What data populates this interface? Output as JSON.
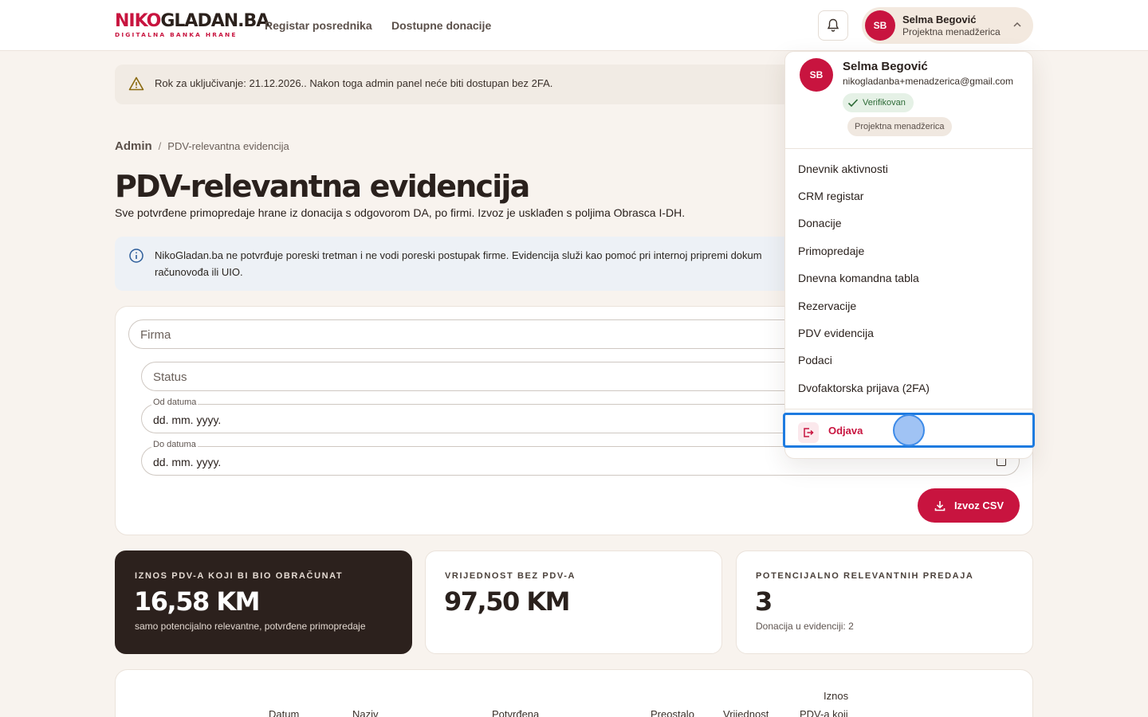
{
  "header": {
    "logo": {
      "part_a": "NIKO",
      "part_b": "GLADAN.BA",
      "tagline": "DIGITALNA BANKA HRANE"
    },
    "nav": [
      "Registar posrednika",
      "Dostupne donacije"
    ],
    "user": {
      "initials": "SB",
      "name": "Selma Begović",
      "role": "Projektna menadžerica"
    }
  },
  "warning": {
    "text": "Rok za uključivanje: 21.12.2026.. Nakon toga admin panel neće biti dostupan bez 2FA."
  },
  "breadcrumb": {
    "root": "Admin",
    "separator": "/",
    "current": "PDV-relevantna evidencija"
  },
  "page": {
    "title": "PDV-relevantna evidencija",
    "subtitle": "Sve potvrđene primopredaje hrane iz donacija s odgovorom DA, po firmi. Izvoz je usklađen s poljima Obrasca I-DH."
  },
  "info": {
    "text": "NikoGladan.ba ne potvrđuje poreski tretman i ne vodi poreski postupak firme. Evidencija služi kao pomoć pri internoj pripremi dokum računovođa ili UIO."
  },
  "filters": {
    "firma_placeholder": "Firma",
    "status_placeholder": "Status",
    "from_label": "Od datuma",
    "from_value": "dd. mm. yyyy.",
    "to_label": "Do datuma",
    "to_value": "dd. mm. yyyy.",
    "export_label": "Izvoz CSV"
  },
  "stats": [
    {
      "label": "IZNOS PDV-A KOJI BI BIO OBRAČUNAT",
      "value": "16,58 KM",
      "note": "samo potencijalno relevantne, potvrđene primopredaje"
    },
    {
      "label": "VRIJEDNOST BEZ PDV-A",
      "value": "97,50 KM",
      "note": ""
    },
    {
      "label": "POTENCIJALNO RELEVANTNIH PREDAJA",
      "value": "3",
      "note": "Donacija u evidenciji: 2"
    }
  ],
  "table": {
    "headers": [
      "Datum",
      "Naziv",
      "Potvrđena",
      "Preostalo",
      "Vrijednost",
      "Iznos",
      "PDV-a koji"
    ]
  },
  "menu": {
    "initials": "SB",
    "name": "Selma Begović",
    "email": "nikogladanba+menadzerica@gmail.com",
    "verified": "Verifikovan",
    "role": "Projektna menadžerica",
    "items": [
      "Dnevnik aktivnosti",
      "CRM registar",
      "Donacije",
      "Primopredaje",
      "Dnevna komandna tabla",
      "Rezervacije",
      "PDV evidencija",
      "Podaci",
      "Dvofaktorska prijava (2FA)"
    ],
    "logout": "Odjava"
  },
  "colors": {
    "brand": "#c8143f",
    "dark_card": "#2c211d",
    "highlight": "#1e7be0"
  }
}
